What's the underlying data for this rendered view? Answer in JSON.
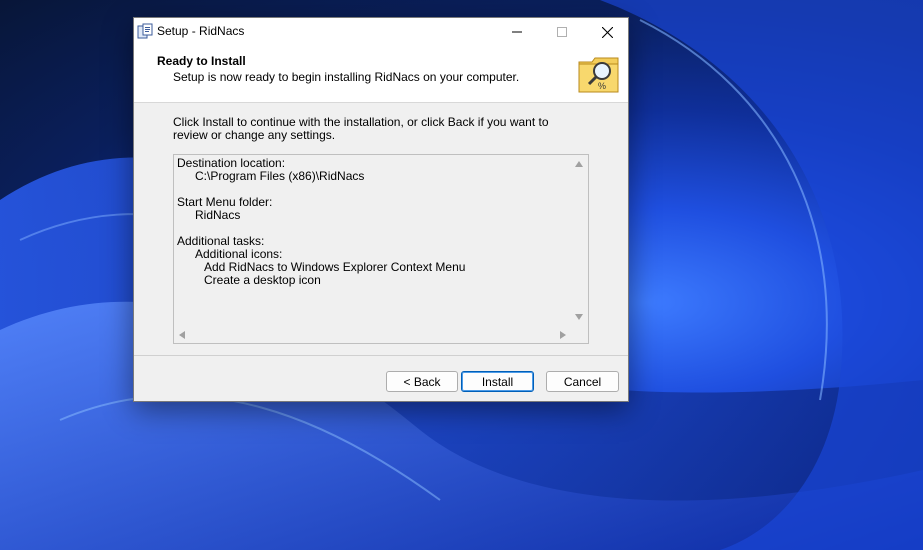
{
  "window": {
    "title": "Setup - RidNacs",
    "app_icon": "setup-installer-icon",
    "controls": {
      "minimize": "minimize-icon",
      "maximize": "maximize-icon",
      "close": "close-icon"
    }
  },
  "header": {
    "title": "Ready to Install",
    "subtitle": "Setup is now ready to begin installing RidNacs on your computer.",
    "icon": "folder-magnifier-icon"
  },
  "instruction": "Click Install to continue with the installation, or click Back if you want to review or change any settings.",
  "memo": {
    "destination_label": "Destination location:",
    "destination_value": "C:\\Program Files (x86)\\RidNacs",
    "start_menu_label": "Start Menu folder:",
    "start_menu_value": "RidNacs",
    "tasks_label": "Additional tasks:",
    "tasks_group": "Additional icons:",
    "tasks": [
      "Add RidNacs to Windows Explorer Context Menu",
      "Create a desktop icon"
    ]
  },
  "buttons": {
    "back": "< Back",
    "install": "Install",
    "cancel": "Cancel"
  },
  "colors": {
    "accent": "#005fb8",
    "wallpaper_primary": "#1f4fe0",
    "dialog_bg": "#f0f0f0"
  }
}
